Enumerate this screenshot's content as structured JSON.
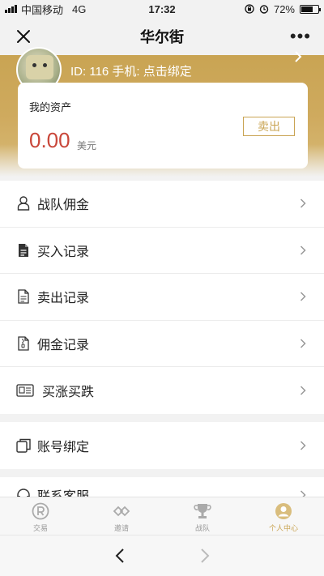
{
  "status": {
    "carrier": "中国移动",
    "network": "4G",
    "time": "17:32",
    "battery": "72%",
    "battery_level": 0.72
  },
  "nav": {
    "title": "华尔街",
    "more_label": "•••",
    "close_icon": "close-icon"
  },
  "user": {
    "id_text": "ID: 116 手机: 点击绑定"
  },
  "asset": {
    "label": "我的资产",
    "amount": "0.00",
    "unit": "美元",
    "sell_label": "卖出",
    "amount_color": "#c9473a",
    "accent_color": "#c9a453"
  },
  "menu": {
    "group1": [
      {
        "label": "战队佣金",
        "icon": "person-icon"
      },
      {
        "label": "买入记录",
        "icon": "document-filled-icon"
      },
      {
        "label": "卖出记录",
        "icon": "document-outline-icon"
      },
      {
        "label": "佣金记录",
        "icon": "zip-file-icon"
      },
      {
        "label": "买涨买跌",
        "icon": "newspaper-icon"
      }
    ],
    "group2": [
      {
        "label": "账号绑定",
        "icon": "copy-icon"
      }
    ],
    "group3_partial": [
      {
        "label": "联系客服",
        "icon": "headset-icon"
      }
    ]
  },
  "tabs": [
    {
      "label": "交易",
      "icon": "registered-icon",
      "active": false
    },
    {
      "label": "邀请",
      "icon": "link-icon",
      "active": false
    },
    {
      "label": "战队",
      "icon": "trophy-icon",
      "active": false
    },
    {
      "label": "个人中心",
      "icon": "user-circle-icon",
      "active": true
    }
  ]
}
